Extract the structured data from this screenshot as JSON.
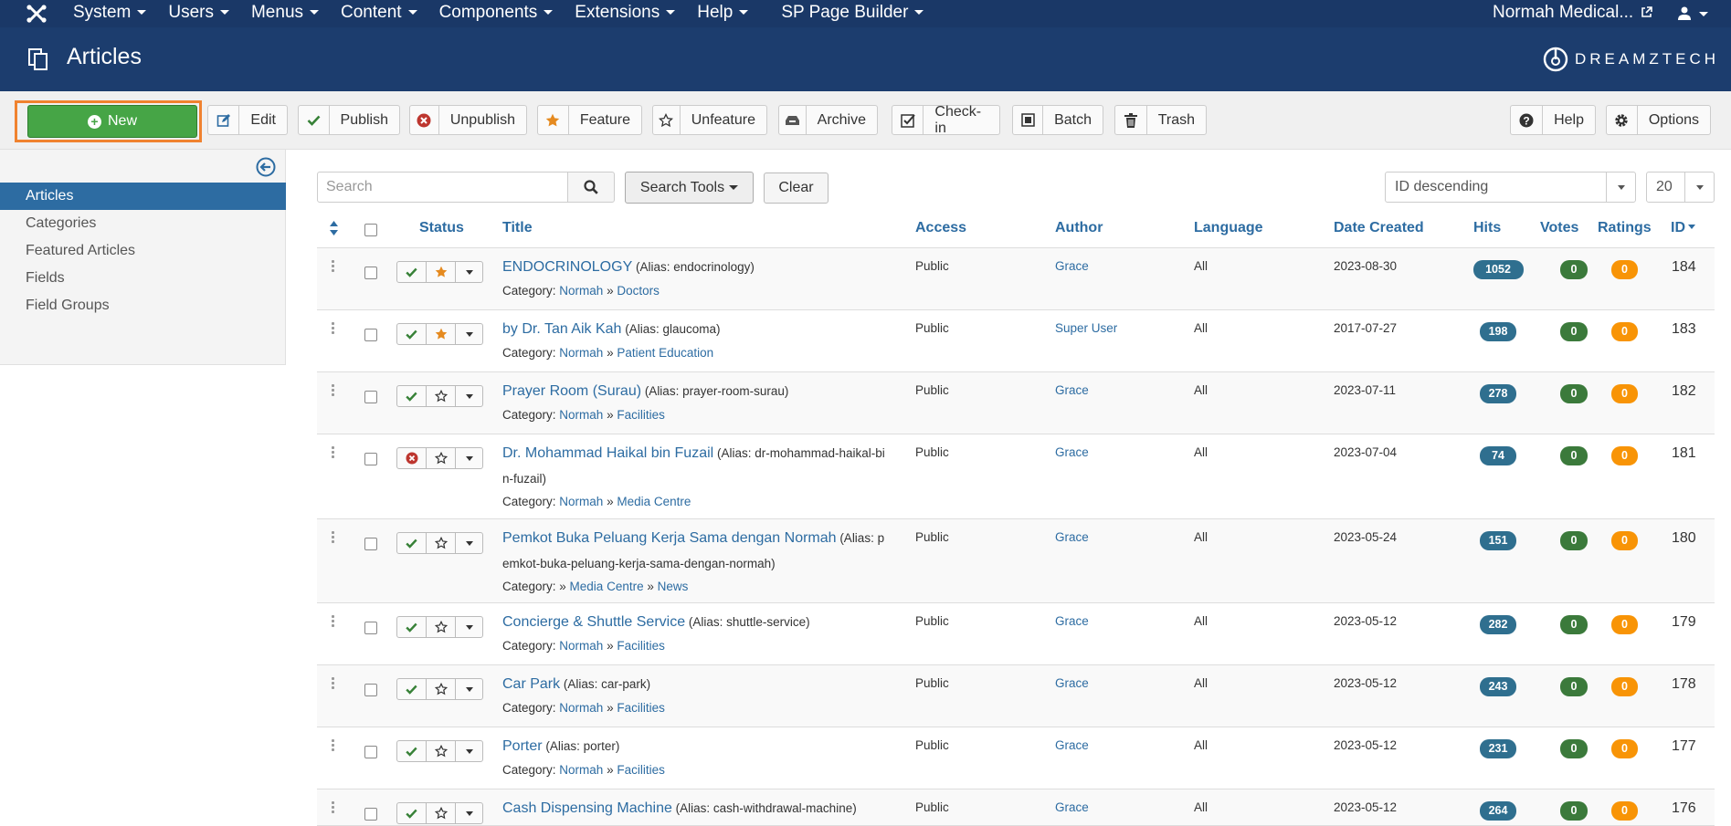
{
  "topnav": {
    "menu": [
      "System",
      "Users",
      "Menus",
      "Content",
      "Components",
      "Extensions",
      "Help",
      "SP Page Builder"
    ],
    "site_name": "Normah Medical..."
  },
  "header": {
    "title": "Articles",
    "brand": "DREAMZTECH"
  },
  "toolbar": {
    "new": "New",
    "edit": "Edit",
    "publish": "Publish",
    "unpublish": "Unpublish",
    "feature": "Feature",
    "unfeature": "Unfeature",
    "archive": "Archive",
    "checkin": "Check-in",
    "batch": "Batch",
    "trash": "Trash",
    "help": "Help",
    "options": "Options"
  },
  "sidebar": {
    "items": [
      "Articles",
      "Categories",
      "Featured Articles",
      "Fields",
      "Field Groups"
    ]
  },
  "filters": {
    "search_placeholder": "Search",
    "search_tools": "Search Tools",
    "clear": "Clear",
    "sort": "ID descending",
    "limit": "20"
  },
  "table": {
    "headers": {
      "status": "Status",
      "title": "Title",
      "access": "Access",
      "author": "Author",
      "language": "Language",
      "date": "Date Created",
      "hits": "Hits",
      "votes": "Votes",
      "ratings": "Ratings",
      "id": "ID"
    },
    "category_prefix": "Category:",
    "rows": [
      {
        "title": "ENDOCRINOLOGY",
        "alias_line1": "(Alias: endocrinology)",
        "alias_line2": "",
        "cat1": "Normah",
        "cat2": "Doctors",
        "access": "Public",
        "author": "Grace",
        "language": "All",
        "date": "2023-08-30",
        "hits": "1052",
        "votes": "0",
        "ratings": "0",
        "id": "184",
        "published": true,
        "featured": true
      },
      {
        "title": "by Dr. Tan Aik Kah",
        "alias_line1": "(Alias: glaucoma)",
        "alias_line2": "",
        "cat1": "Normah",
        "cat2": "Patient Education",
        "access": "Public",
        "author": "Super User",
        "language": "All",
        "date": "2017-07-27",
        "hits": "198",
        "votes": "0",
        "ratings": "0",
        "id": "183",
        "published": true,
        "featured": true
      },
      {
        "title": "Prayer Room (Surau)",
        "alias_line1": "(Alias: prayer-room-surau)",
        "alias_line2": "",
        "cat1": "Normah",
        "cat2": "Facilities",
        "access": "Public",
        "author": "Grace",
        "language": "All",
        "date": "2023-07-11",
        "hits": "278",
        "votes": "0",
        "ratings": "0",
        "id": "182",
        "published": true,
        "featured": false
      },
      {
        "title": "Dr. Mohammad Haikal bin Fuzail",
        "alias_line1": "(Alias: dr-mohammad-haikal-bi",
        "alias_line2": "n-fuzail)",
        "cat1": "Normah",
        "cat2": "Media Centre",
        "access": "Public",
        "author": "Grace",
        "language": "All",
        "date": "2023-07-04",
        "hits": "74",
        "votes": "0",
        "ratings": "0",
        "id": "181",
        "published": false,
        "featured": false
      },
      {
        "title": "Pemkot Buka Peluang Kerja Sama dengan Normah",
        "alias_line1": "(Alias: p",
        "alias_line2": "emkot-buka-peluang-kerja-sama-dengan-normah)",
        "cat1": "",
        "cat2": "Media Centre",
        "cat3": "News",
        "access": "Public",
        "author": "Grace",
        "language": "All",
        "date": "2023-05-24",
        "hits": "151",
        "votes": "0",
        "ratings": "0",
        "id": "180",
        "published": true,
        "featured": false
      },
      {
        "title": "Concierge & Shuttle Service",
        "alias_line1": "(Alias: shuttle-service)",
        "alias_line2": "",
        "cat1": "Normah",
        "cat2": "Facilities",
        "access": "Public",
        "author": "Grace",
        "language": "All",
        "date": "2023-05-12",
        "hits": "282",
        "votes": "0",
        "ratings": "0",
        "id": "179",
        "published": true,
        "featured": false
      },
      {
        "title": "Car Park",
        "alias_line1": "(Alias: car-park)",
        "alias_line2": "",
        "cat1": "Normah",
        "cat2": "Facilities",
        "access": "Public",
        "author": "Grace",
        "language": "All",
        "date": "2023-05-12",
        "hits": "243",
        "votes": "0",
        "ratings": "0",
        "id": "178",
        "published": true,
        "featured": false
      },
      {
        "title": "Porter",
        "alias_line1": "(Alias: porter)",
        "alias_line2": "",
        "cat1": "Normah",
        "cat2": "Facilities",
        "access": "Public",
        "author": "Grace",
        "language": "All",
        "date": "2023-05-12",
        "hits": "231",
        "votes": "0",
        "ratings": "0",
        "id": "177",
        "published": true,
        "featured": false
      },
      {
        "title": "Cash Dispensing Machine",
        "alias_line1": "(Alias: cash-withdrawal-machine)",
        "alias_line2": "",
        "cat1": "",
        "cat2": "",
        "access": "Public",
        "author": "Grace",
        "language": "All",
        "date": "2023-05-12",
        "hits": "264",
        "votes": "0",
        "ratings": "0",
        "id": "176",
        "published": true,
        "featured": false
      }
    ]
  },
  "colors": {
    "nav": "#1a3867",
    "header": "#1c3d6e",
    "link": "#2d6ca2",
    "new_button": "#46a546",
    "highlight": "#f0822f",
    "hits_badge": "#2f6f8f",
    "votes_badge": "#3b7a3b",
    "ratings_badge": "#f89406"
  }
}
